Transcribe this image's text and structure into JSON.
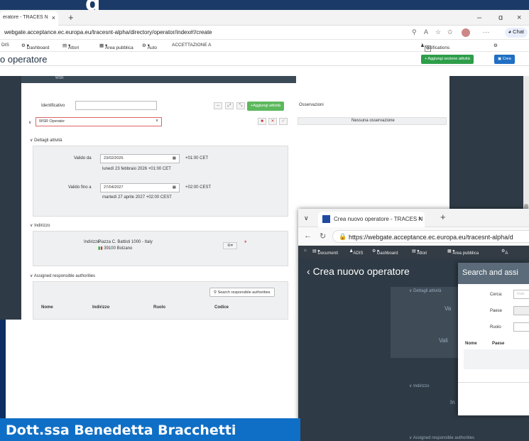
{
  "banner": {
    "text": "g"
  },
  "w1": {
    "tab_title": "eratore - TRACES N",
    "tab_close": "×",
    "newtab": "+",
    "minimize": "–",
    "restore": "ɑ",
    "close": "×",
    "url": "webgate.acceptance.ec.europa.eu/tracesnt-alpha/directory/operator/index#!/create",
    "chat": "Chat",
    "bm": [
      "DIS",
      "Dashboard",
      "Attori",
      "Area pubblica",
      "Auto",
      "ACCETTAZIONE A"
    ],
    "notifications": "Notifications",
    "notif_count": "0",
    "page_title": "o operatore",
    "btn_add_section": "+ Aggiungi sezione attività",
    "btn_create": "Crea",
    "strip": "WSR"
  },
  "form": {
    "identificativo": "Identificativo",
    "btn_add_activity": "+Aggiungi attività",
    "activity": "WSR Operator",
    "dettagli": "Dettagli attività",
    "valido_da": "Valido da",
    "date_from": "23/02/2026",
    "tz_from": "+01:00 CET",
    "date_from_long": "lunedì 23 febbraio 2026 +01:00 CET",
    "valido_fino": "Valido fino a",
    "date_to": "27/04/2027",
    "tz_to": "+02:00 CEST",
    "date_to_long": "martedì 27 aprile 2027 +02:00 CEST",
    "indirizzo_sec": "Indirizzo",
    "indirizzo_lbl": "Indirizzo",
    "address1": "Piazza C. Battisti 1000 - Italy",
    "address2": "39100 Bolzano",
    "auth_sec": "Assigned responsible authorities",
    "btn_search_auth": "Search responsible authorities",
    "cols": [
      "Nome",
      "Indirizzo",
      "Ruolo",
      "Codice"
    ]
  },
  "obs": {
    "title": "Osservazioni",
    "none": "Nessuna osservazione"
  },
  "w2": {
    "tab_title": "Crea nuovo operatore - TRACES N",
    "tab_close": "×",
    "newtab": "+",
    "url": "https://webgate.acceptance.ec.europa.eu/tracesnt-alpha/d",
    "bm": [
      "Documenti",
      "ADIS",
      "Dashboard",
      "Attori",
      "Area pubblica",
      "A"
    ],
    "page_title": "Crea nuovo operatore",
    "dettagli": "Dettagli attività",
    "indirizzo": "Indirizzo",
    "auth": "Assigned responsible authorities",
    "va": "Va",
    "vali": "Vali",
    "in": "In"
  },
  "dialog": {
    "title": "Search and assi",
    "cerca": "Cerca:",
    "paese": "Paese",
    "ruolo": "Ruolo",
    "col_nome": "Nome",
    "col_paese": "Paese",
    "placeholder": "Inse"
  },
  "namebar": {
    "text": "Dott.ssa Benedetta Bracchetti"
  }
}
